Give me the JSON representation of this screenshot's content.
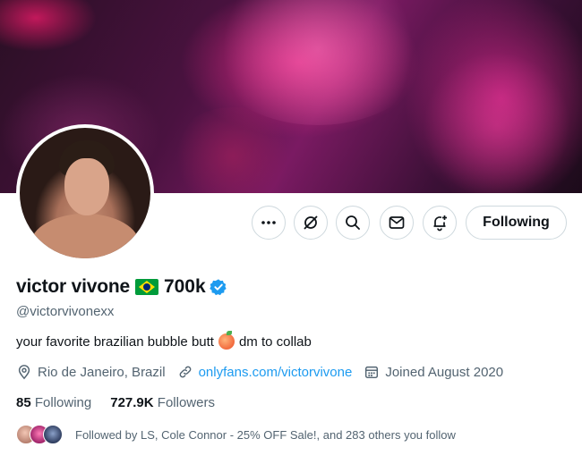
{
  "profile": {
    "name": "victor vivone",
    "name_suffix": "700k",
    "handle": "@victorvivonexx",
    "bio_before": "your favorite brazilian bubble butt",
    "bio_after": "dm to collab",
    "location": "Rio de Janeiro, Brazil",
    "website": "onlyfans.com/victorvivone",
    "joined": "Joined August 2020"
  },
  "stats": {
    "following_count": "85",
    "following_label": "Following",
    "followers_count": "727.9K",
    "followers_label": "Followers"
  },
  "followed_by": {
    "text": "Followed by LS, Cole Connor - 25% OFF Sale!, and 283 others you follow"
  },
  "actions": {
    "follow_label": "Following",
    "icons": [
      "more-icon",
      "grok-icon",
      "search-icon",
      "message-icon",
      "notification-add-icon"
    ]
  },
  "colors": {
    "accent": "#1d9bf0",
    "secondary_text": "#536471",
    "border": "#cfd9de",
    "verified": "#1d9bf0"
  }
}
